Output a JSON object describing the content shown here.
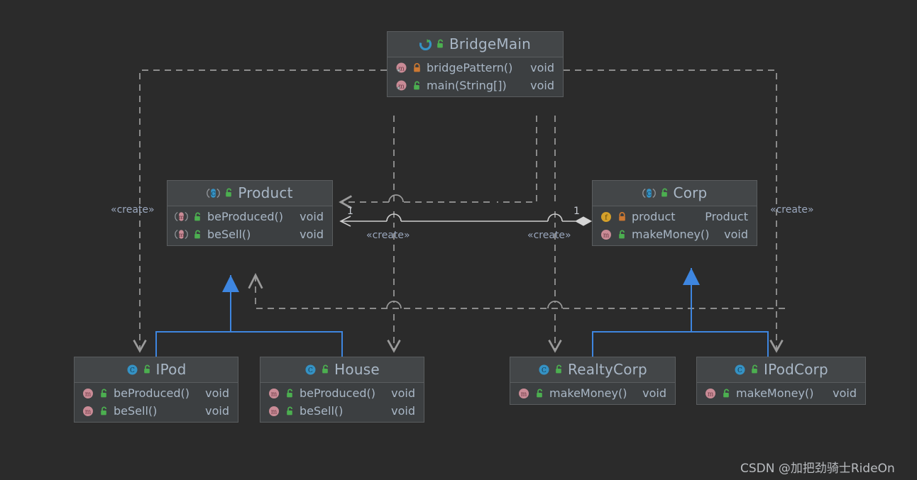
{
  "diagram": {
    "kind": "uml-class-diagram",
    "background_color": "#2b2b2b",
    "node_fill": "#3c3f41",
    "node_border": "#5a5d5f",
    "text_color": "#a9b7c6",
    "realization_color": "#3e86e0",
    "dependency_color": "#9b9b9b"
  },
  "nodes": {
    "bridgemain": {
      "title": "BridgeMain",
      "icon": "class-runnable-icon",
      "visibility_icon": "unlock-green-icon",
      "members": [
        {
          "name": "bridgePattern()",
          "type": "void",
          "kind_icon": "method-icon",
          "access_icon": "lock-orange-icon"
        },
        {
          "name": "main(String[])",
          "type": "void",
          "kind_icon": "method-icon",
          "access_icon": "unlock-green-icon"
        }
      ]
    },
    "product": {
      "title": "Product",
      "icon": "interface-icon",
      "visibility_icon": "unlock-green-icon",
      "members": [
        {
          "name": "beProduced()",
          "type": "void",
          "kind_icon": "method-abstract-icon",
          "access_icon": "unlock-green-icon"
        },
        {
          "name": "beSell()",
          "type": "void",
          "kind_icon": "method-abstract-icon",
          "access_icon": "unlock-green-icon"
        }
      ]
    },
    "corp": {
      "title": "Corp",
      "icon": "interface-icon",
      "visibility_icon": "unlock-green-icon",
      "members": [
        {
          "name": "product",
          "type": "Product",
          "kind_icon": "field-icon",
          "access_icon": "lock-orange-icon"
        },
        {
          "name": "makeMoney()",
          "type": "void",
          "kind_icon": "method-icon",
          "access_icon": "unlock-green-icon"
        }
      ]
    },
    "ipod": {
      "title": "IPod",
      "icon": "class-icon",
      "visibility_icon": "unlock-green-icon",
      "members": [
        {
          "name": "beProduced()",
          "type": "void",
          "kind_icon": "method-icon",
          "access_icon": "unlock-green-icon"
        },
        {
          "name": "beSell()",
          "type": "void",
          "kind_icon": "method-icon",
          "access_icon": "unlock-green-icon"
        }
      ]
    },
    "house": {
      "title": "House",
      "icon": "class-icon",
      "visibility_icon": "unlock-green-icon",
      "members": [
        {
          "name": "beProduced()",
          "type": "void",
          "kind_icon": "method-icon",
          "access_icon": "unlock-green-icon"
        },
        {
          "name": "beSell()",
          "type": "void",
          "kind_icon": "method-icon",
          "access_icon": "unlock-green-icon"
        }
      ]
    },
    "realtycorp": {
      "title": "RealtyCorp",
      "icon": "class-icon",
      "visibility_icon": "unlock-green-icon",
      "members": [
        {
          "name": "makeMoney()",
          "type": "void",
          "kind_icon": "method-icon",
          "access_icon": "unlock-green-icon"
        }
      ]
    },
    "ipodcorp": {
      "title": "IPodCorp",
      "icon": "class-icon",
      "visibility_icon": "unlock-green-icon",
      "members": [
        {
          "name": "makeMoney()",
          "type": "void",
          "kind_icon": "method-icon",
          "access_icon": "unlock-green-icon"
        }
      ]
    }
  },
  "edge_labels": {
    "create_left": "«create»",
    "create_mid_left": "«create»",
    "create_mid_right": "«create»",
    "create_right": "«create»",
    "mult_product": "1",
    "mult_corp": "1"
  },
  "watermark": "CSDN @加把劲骑士RideOn"
}
